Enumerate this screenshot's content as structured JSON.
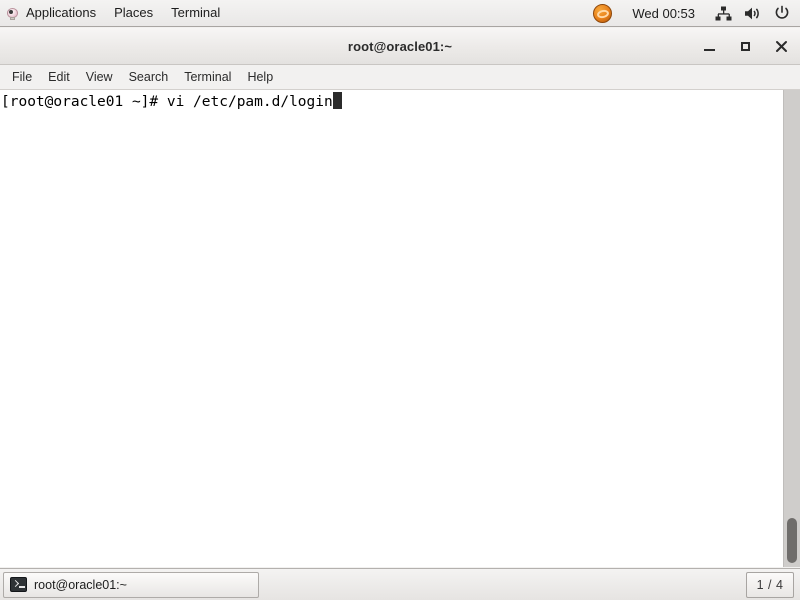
{
  "top_panel": {
    "applications": {
      "label": "Applications",
      "icon": "applications-logo-icon"
    },
    "places": {
      "label": "Places"
    },
    "terminal": {
      "label": "Terminal"
    },
    "tray": {
      "oracle_icon": "oracle-linux-badge-icon",
      "clock": "Wed 00:53",
      "network_icon": "network-wired-icon",
      "volume_icon": "volume-speaker-icon",
      "power_icon": "power-button-icon"
    }
  },
  "window": {
    "title": "root@oracle01:~",
    "controls": {
      "minimize": "minimize-icon",
      "maximize": "maximize-icon",
      "close": "✕"
    },
    "menubar": [
      {
        "label": "File"
      },
      {
        "label": "Edit"
      },
      {
        "label": "View"
      },
      {
        "label": "Search"
      },
      {
        "label": "Terminal"
      },
      {
        "label": "Help"
      }
    ]
  },
  "terminal": {
    "lines": [
      "[root@oracle01 ~]# vi /etc/pam.d/login"
    ],
    "cursor": "block",
    "foreground": "#000000",
    "background": "#ffffff"
  },
  "bottom_panel": {
    "task": {
      "label": "root@oracle01:~",
      "icon": "terminal-icon"
    },
    "workspace": "1 / 4"
  }
}
